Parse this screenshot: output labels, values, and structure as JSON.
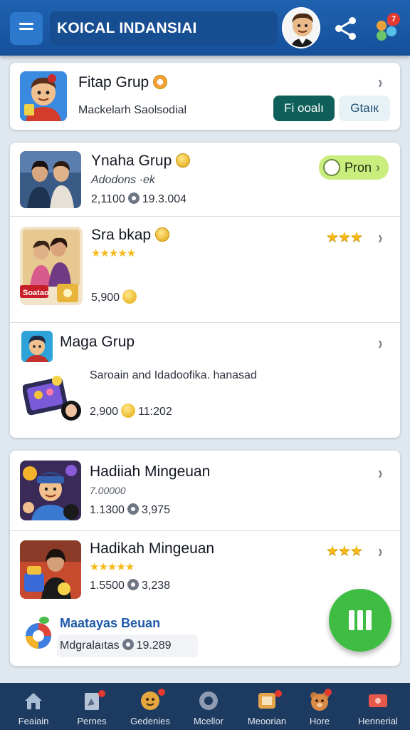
{
  "header": {
    "title": "KOICAL INDANSIAI"
  },
  "featured": {
    "title": "Fitap Grup",
    "subtitle": "Mackelarh Saolsodial",
    "primary_button": "Fi ooalı",
    "secondary_button": "Gtaıк"
  },
  "groups": [
    {
      "title": "Ynaha Grup",
      "line1": "Adodons ·ek",
      "line2_a": "2,1100",
      "line2_b": "19.3.004",
      "pill": "Pron"
    },
    {
      "title": "Sra bkap",
      "line2_a": "5,900"
    },
    {
      "title": "Maga Grup",
      "desc": "Saroain and Idadoofika. hanasad",
      "line2_a": "2,900",
      "line2_b": "11:202"
    }
  ],
  "gifts": [
    {
      "title": "Hadiiah Mingeuan",
      "line1": "7.00000",
      "line2_a": "1.1300",
      "line2_b": "3,975"
    },
    {
      "title": "Hadikah Mingeuan",
      "line2_a": "1.5500",
      "line2_b": "3,238"
    },
    {
      "title": "Maatayas Beuan",
      "line2_a": "Mdgralaıtas",
      "line2_b": "19.289"
    }
  ],
  "nav": [
    {
      "label": "Feaiain",
      "icon": "home-icon"
    },
    {
      "label": "Pernes",
      "icon": "document-icon"
    },
    {
      "label": "Gedenies",
      "icon": "mascot-icon"
    },
    {
      "label": "Mcellor",
      "icon": "disc-icon"
    },
    {
      "label": "Meoorian",
      "icon": "frame-icon"
    },
    {
      "label": "Hore",
      "icon": "bear-icon"
    },
    {
      "label": "Hennerial",
      "icon": "ticket-icon"
    }
  ],
  "colors": {
    "header": "#1f62b0",
    "primary_button": "#0f5f5a",
    "accent_green": "#3fbd43",
    "star": "#f5b816",
    "nav_bg": "#1d3a60"
  }
}
